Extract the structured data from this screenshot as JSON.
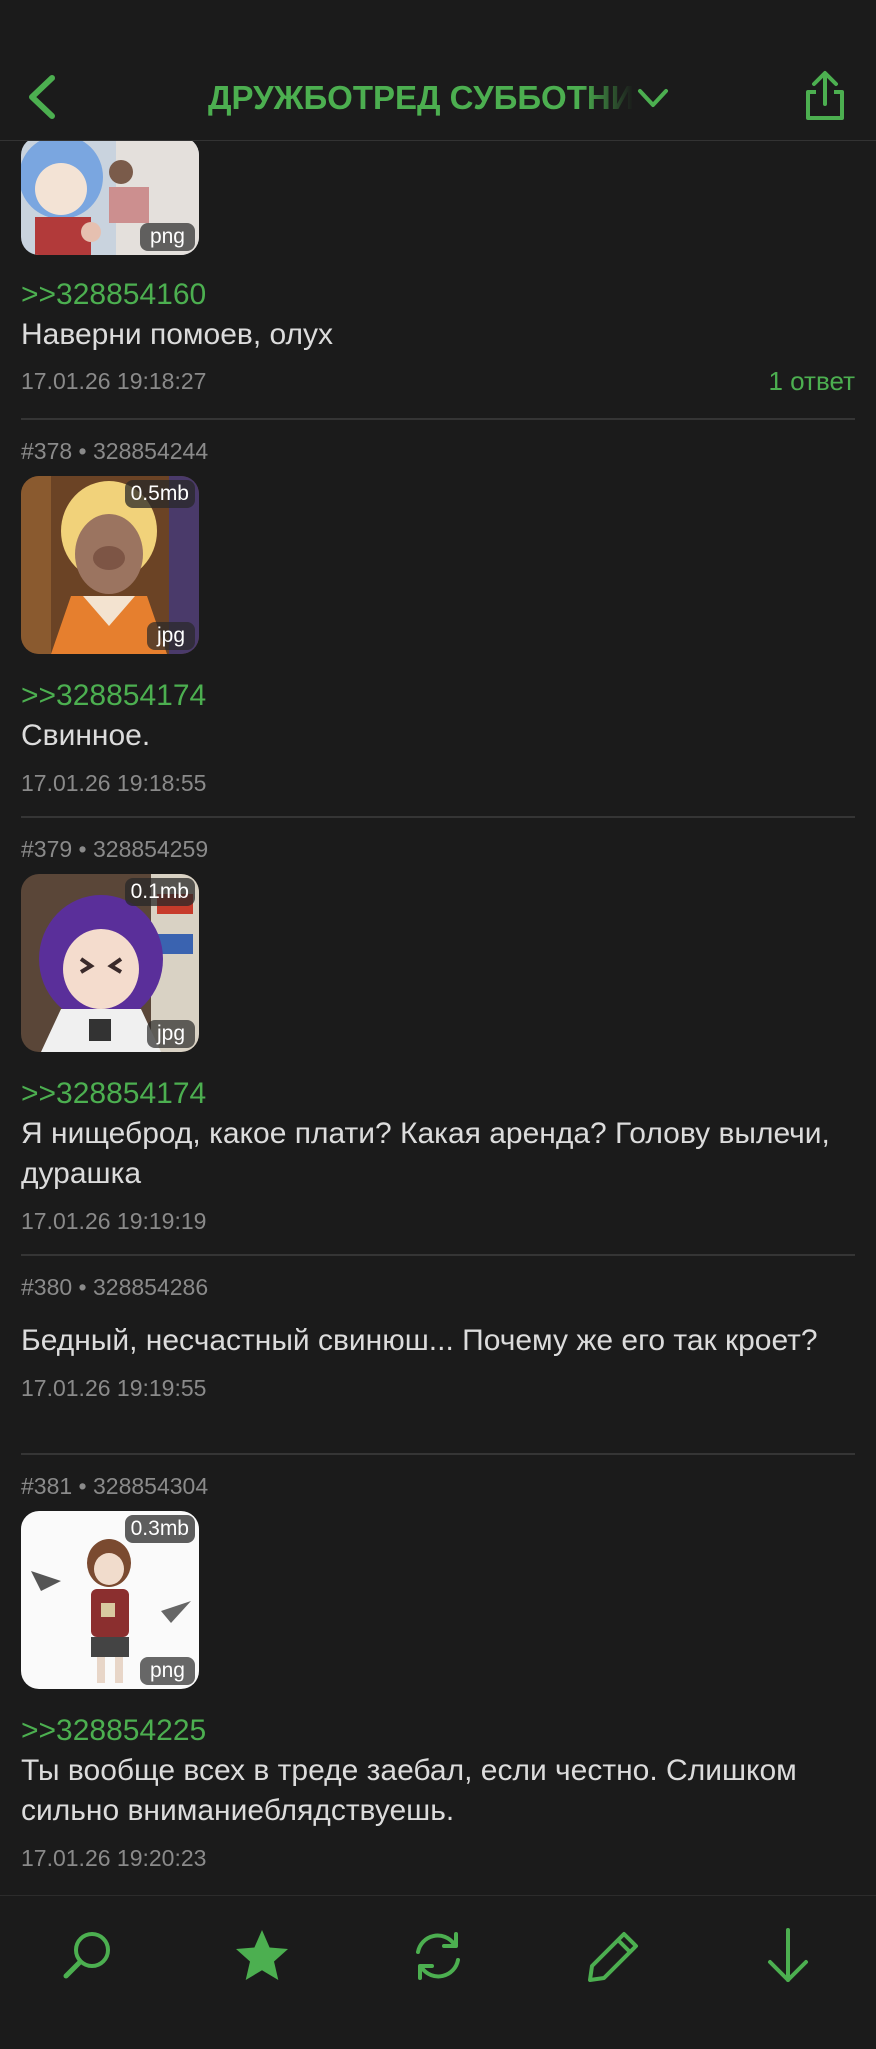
{
  "header": {
    "title": "ДРУЖБОТРЕД СУББОТНИЙ",
    "back_icon": "chevron-left-icon",
    "dropdown_icon": "chevron-down-icon",
    "share_icon": "share-icon",
    "accent": "#4caf50"
  },
  "posts": [
    {
      "thumb_type": "png",
      "reply_to": ">>328854160",
      "text": "Наверни помоев, олух",
      "date": "17.01.26 19:18:27",
      "replies": "1 ответ"
    },
    {
      "meta": "#378 • 328854244",
      "thumb_size": "0.5mb",
      "thumb_type": "jpg",
      "reply_to": ">>328854174",
      "text": "Свинное.",
      "date": "17.01.26 19:18:55"
    },
    {
      "meta": "#379 • 328854259",
      "thumb_size": "0.1mb",
      "thumb_type": "jpg",
      "reply_to": ">>328854174",
      "text": "Я нищеброд, какое плати? Какая аренда? Голову вылечи, дурашка",
      "date": "17.01.26 19:19:19"
    },
    {
      "meta": "#380 • 328854286",
      "text": "Бедный, несчастный свинюш... Почему же его так кроет?",
      "date": "17.01.26 19:19:55"
    },
    {
      "meta": "#381 • 328854304",
      "thumb_size": "0.3mb",
      "thumb_type": "png",
      "reply_to": ">>328854225",
      "text": "Ты вообще всех в треде заебал, если честно. Слишком сильно вниманиеблядствуешь.",
      "date": "17.01.26 19:20:23"
    }
  ],
  "toolbar": {
    "icons": [
      "search-icon",
      "star-icon",
      "refresh-icon",
      "pencil-icon",
      "arrow-down-icon"
    ]
  }
}
